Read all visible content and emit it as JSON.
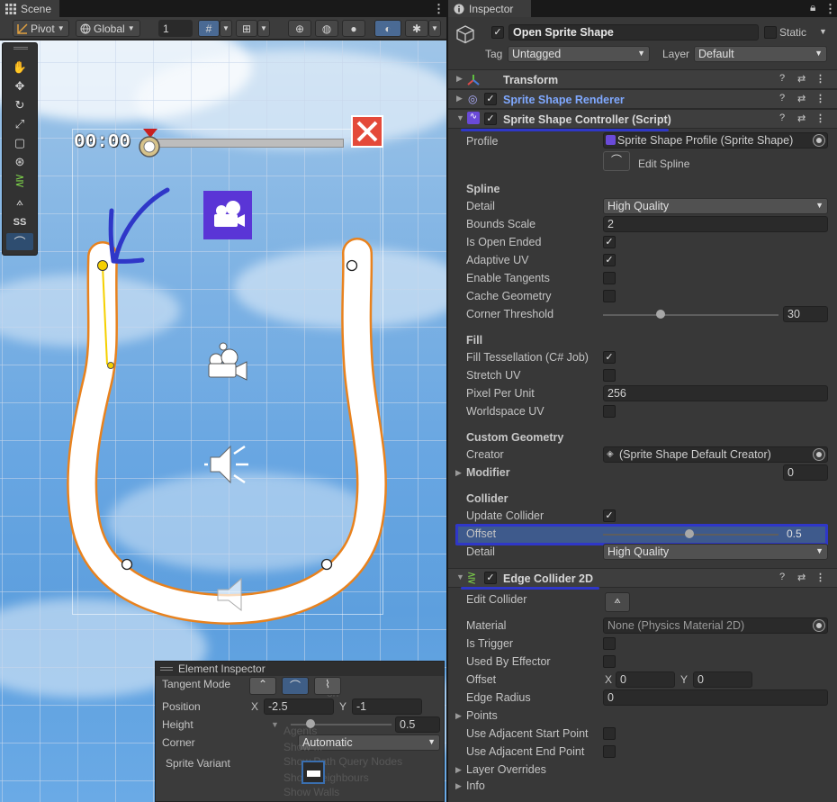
{
  "scene_tab": {
    "label": "Scene"
  },
  "scene_toolbar": {
    "pivot": "Pivot",
    "global": "Global",
    "grid_value": "1"
  },
  "tool_strip": {
    "ss_label": "SS"
  },
  "game": {
    "timer": "00:00"
  },
  "element_inspector": {
    "title": "Element Inspector",
    "tangent_mode_label": "Tangent Mode",
    "position_label": "Position",
    "position_x_label": "X",
    "position_x": "-2.5",
    "position_y_label": "Y",
    "position_y": "-1",
    "height_label": "Height",
    "height_value": "0.5",
    "height_level": 0.5,
    "corner_label": "Corner",
    "corner_value": "Automatic",
    "sprite_variant_label": "Sprite Variant"
  },
  "inspector": {
    "tab_label": "Inspector",
    "object_name": "Open Sprite Shape",
    "static_label": "Static",
    "tag_label": "Tag",
    "tag_value": "Untagged",
    "layer_label": "Layer",
    "layer_value": "Default",
    "components": {
      "transform": "Transform",
      "renderer": "Sprite Shape Renderer",
      "controller": "Sprite Shape Controller (Script)",
      "edge": "Edge Collider 2D"
    },
    "controller": {
      "profile_label": "Profile",
      "profile_value": "Sprite Shape Profile (Sprite Shape)",
      "edit_spline": "Edit Spline",
      "spline_section": "Spline",
      "detail_label": "Detail",
      "detail_value": "High Quality",
      "bounds_label": "Bounds Scale",
      "bounds_value": "2",
      "open_ended_label": "Is Open Ended",
      "adaptive_label": "Adaptive UV",
      "tangents_label": "Enable Tangents",
      "cache_label": "Cache Geometry",
      "corner_label": "Corner Threshold",
      "corner_value": "30",
      "corner_level": 0.33,
      "fill_section": "Fill",
      "tess_label": "Fill Tessellation (C# Job)",
      "stretch_label": "Stretch UV",
      "ppu_label": "Pixel Per Unit",
      "ppu_value": "256",
      "worldspace_label": "Worldspace UV",
      "custom_section": "Custom Geometry",
      "creator_label": "Creator",
      "creator_value": "(Sprite Shape Default Creator)",
      "modifier_label": "Modifier",
      "modifier_value": "0",
      "collider_section": "Collider",
      "update_label": "Update Collider",
      "offset_label": "Offset",
      "offset_value": "0.5",
      "offset_level": 0.5,
      "collider_detail_label": "Detail",
      "collider_detail_value": "High Quality"
    },
    "edge": {
      "edit_label": "Edit Collider",
      "material_label": "Material",
      "material_value": "None (Physics Material 2D)",
      "trigger_label": "Is Trigger",
      "effector_label": "Used By Effector",
      "offset_label": "Offset",
      "offset_x_label": "X",
      "offset_x": "0",
      "offset_y_label": "Y",
      "offset_y": "0",
      "radius_label": "Edge Radius",
      "radius_value": "0",
      "points_label": "Points",
      "adj_start_label": "Use Adjacent Start Point",
      "adj_end_label": "Use Adjacent End Point",
      "layer_overrides_label": "Layer Overrides",
      "info_label": "Info"
    }
  },
  "colors": {
    "annotation": "#2f37c8",
    "shape_outline": "#e8821e",
    "selected_point": "#f5d000"
  }
}
